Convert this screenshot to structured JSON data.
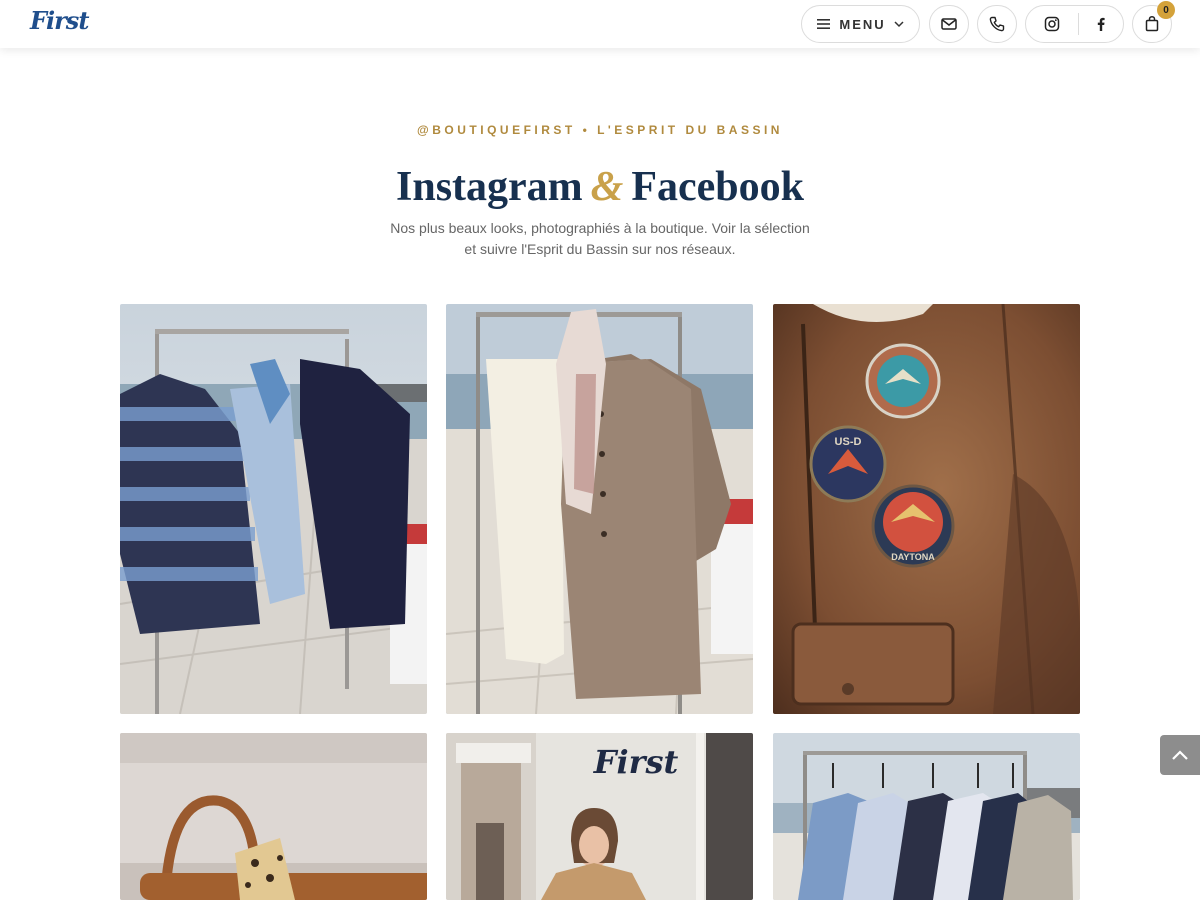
{
  "header": {
    "logo_text": "First",
    "menu_label": "MENU",
    "cart_count": "0",
    "icons": [
      "hamburger-icon",
      "chevron-down-icon",
      "mail-icon",
      "phone-icon",
      "instagram-icon",
      "facebook-icon",
      "shopping-bag-icon"
    ]
  },
  "section": {
    "eyebrow": "@BOUTIQUEFIRST • L'ESPRIT DU BASSIN",
    "title_part1": "Instagram",
    "title_amp": "&",
    "title_part2": "Facebook",
    "subtitle": "Nos plus beaux looks, photographiés à la boutique. Voir la sélection et suivre l'Esprit du Bassin sur nos réseaux."
  },
  "gallery": {
    "tiles": [
      {
        "name": "tile-checked-jacket-rack"
      },
      {
        "name": "tile-shearling-coat-rack"
      },
      {
        "name": "tile-leather-jacket-patches",
        "patch_text": [
          "US-D",
          "DAYTONA"
        ]
      },
      {
        "name": "tile-leather-bag"
      },
      {
        "name": "tile-boutique-woman",
        "sign_text": "First"
      },
      {
        "name": "tile-vests-rack"
      }
    ]
  },
  "scroll_top": {
    "icon": "chevron-up-icon"
  },
  "colors": {
    "accent_gold": "#c9a14a",
    "eyebrow_gold": "#b08a3e",
    "title_navy": "#17304f",
    "logo_blue": "#1f4e8c",
    "badge": "#d4a23a"
  }
}
